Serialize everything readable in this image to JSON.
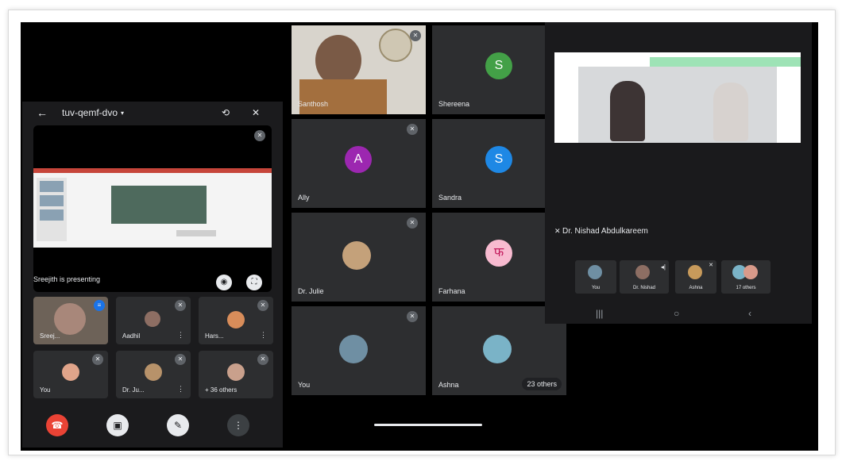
{
  "left_phone": {
    "meeting_code": "tuv-qemf-dvo",
    "presenting_label": "Sreejith is presenting",
    "participants": [
      {
        "name": "Sreej..."
      },
      {
        "name": "Aadhil"
      },
      {
        "name": "Hars..."
      },
      {
        "name": "You"
      },
      {
        "name": "Dr. Ju..."
      },
      {
        "name": "+ 36 others"
      }
    ]
  },
  "middle_grid": {
    "tiles": [
      {
        "name": "Santhosh",
        "type": "video"
      },
      {
        "name": "Shereena",
        "initial": "S",
        "color": "#43a047"
      },
      {
        "name": "Ally",
        "initial": "A",
        "color": "#9c27b0"
      },
      {
        "name": "Sandra",
        "initial": "S",
        "color": "#1e88e5"
      },
      {
        "name": "Dr. Julie",
        "type": "photo"
      },
      {
        "name": "Farhana",
        "initial": "फ",
        "color": "#f8bbd0"
      },
      {
        "name": "You",
        "type": "photo"
      },
      {
        "name": "Ashna",
        "type": "photo"
      }
    ],
    "others_count": "23 others"
  },
  "right_phone": {
    "presenter_name": "Dr. Nishad Abdulkareem",
    "participants": [
      {
        "name": "You"
      },
      {
        "name": "Dr. Nishad"
      },
      {
        "name": "Ashna"
      },
      {
        "name": "17 others"
      }
    ]
  }
}
